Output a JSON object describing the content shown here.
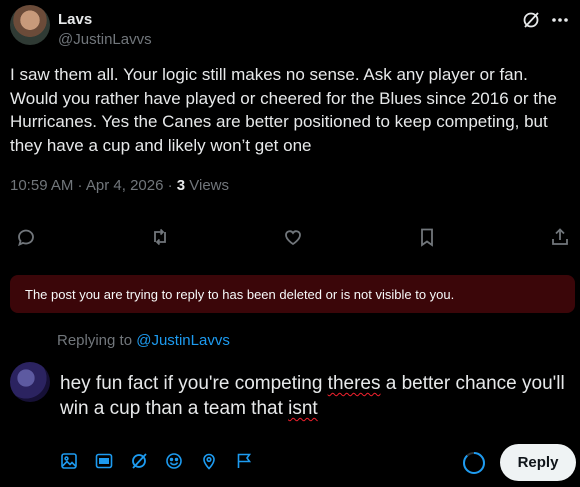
{
  "post": {
    "author_name": "Lavs",
    "author_handle": "@JustinLavvs",
    "text": "I saw them all. Your logic still makes no sense. Ask any player or fan. Would you rather have played or cheered for the Blues since 2016 or the Hurricanes. Yes the Canes are better positioned to keep competing, but they have a cup and likely won’t get one",
    "timestamp": "10:59 AM · Apr 4, 2026 · ",
    "views_count": "3",
    "views_label": " Views"
  },
  "top_icons": [
    "grok-icon",
    "more-icon"
  ],
  "actions": [
    "reply-icon",
    "repost-icon",
    "like-icon",
    "bookmark-icon",
    "share-icon"
  ],
  "notice": {
    "text": "The post you are trying to reply to has been deleted or is not visible to you."
  },
  "reply": {
    "replying_prefix": "Replying to ",
    "replying_to": "@JustinLavvs",
    "text_part1": "hey fun fact if you're competing ",
    "text_misspelled1": "theres",
    "text_part2": " a better chance you'll win a cup than a team that ",
    "text_misspelled2": "isnt",
    "button_label": "Reply"
  },
  "composer_tools": [
    "media-icon",
    "gif-icon",
    "grok-icon",
    "emoji-icon",
    "location-icon",
    "schedule-icon"
  ],
  "colors": {
    "background": "#000000",
    "text": "#e7e9ea",
    "muted": "#71767b",
    "accent": "#1d9bf0",
    "notice_bg": "#3b0609",
    "spell_error": "#f4212e"
  }
}
